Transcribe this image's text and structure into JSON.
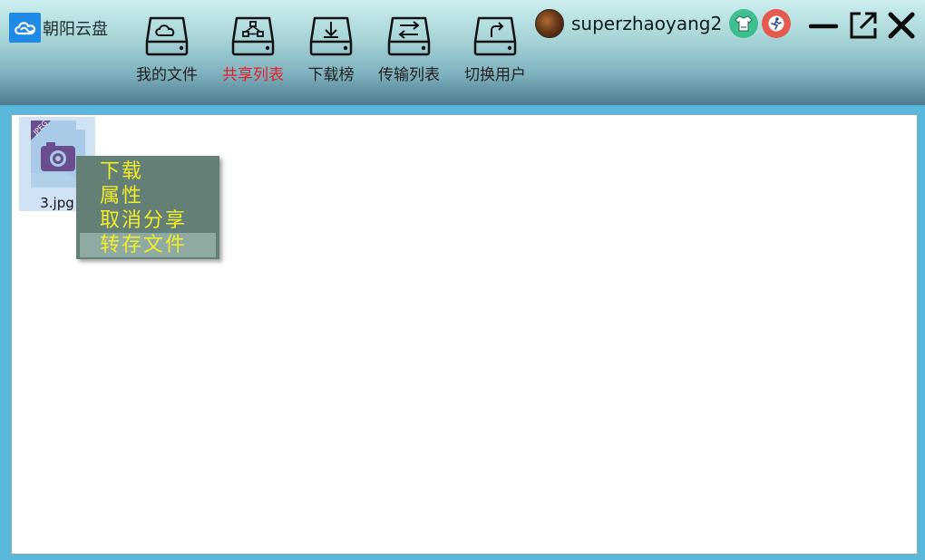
{
  "app": {
    "title": "朝阳云盘",
    "logo_icon": "cloud-logo-icon",
    "accent": "#1f8be6"
  },
  "nav": {
    "items": [
      {
        "label": "我的文件",
        "icon": "cloud-drive-icon",
        "active": false
      },
      {
        "label": "共享列表",
        "icon": "share-drive-icon",
        "active": true
      },
      {
        "label": "下载榜",
        "icon": "download-drive-icon",
        "active": false
      },
      {
        "label": "传输列表",
        "icon": "transfer-drive-icon",
        "active": false
      },
      {
        "label": "切换用户",
        "icon": "switch-user-drive-icon",
        "active": false
      }
    ],
    "active_color": "#e0202a"
  },
  "user": {
    "name": "superzhaoyang2"
  },
  "files": [
    {
      "name": "3.jpg",
      "type_label": "JPEG"
    }
  ],
  "context_menu": {
    "items": [
      "下载",
      "属性",
      "取消分享",
      "转存文件"
    ],
    "text_color": "#f2ee2a",
    "bg_color": "#647f75"
  }
}
